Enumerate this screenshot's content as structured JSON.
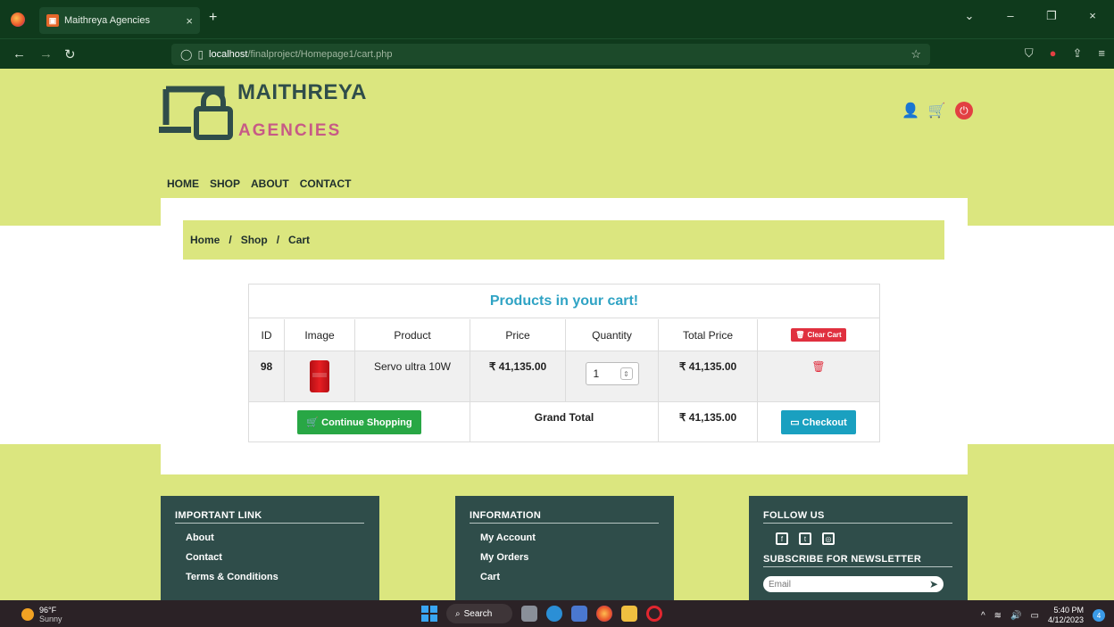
{
  "browser": {
    "tab_title": "Maithreya Agencies",
    "tab_close": "×",
    "new_tab": "+",
    "url_host": "localhost",
    "url_path": "/finalproject/Homepage1/cart.php",
    "window_controls": [
      "⌄",
      "–",
      "❐",
      "×"
    ]
  },
  "site": {
    "brand_line1": "MAITHREYA",
    "brand_line2": "AGENCIES",
    "menu": [
      "HOME",
      "SHOP",
      "ABOUT",
      "CONTACT"
    ],
    "breadcrumb": [
      "Home",
      "/",
      "Shop",
      "/",
      "Cart"
    ]
  },
  "cart": {
    "title": "Products in your cart!",
    "headers": [
      "ID",
      "Image",
      "Product",
      "Price",
      "Quantity",
      "Total Price"
    ],
    "clear_label": "Clear Cart",
    "items": [
      {
        "id": "98",
        "product": "Servo ultra 10W",
        "price": "₹ 41,135.00",
        "quantity": "1",
        "total": "₹ 41,135.00"
      }
    ],
    "continue_label": "Continue Shopping",
    "grand_total_label": "Grand Total",
    "grand_total": "₹ 41,135.00",
    "checkout_label": "Checkout"
  },
  "footer": {
    "important_title": "IMPORTANT LINK",
    "important_links": [
      "About",
      "Contact",
      "Terms & Conditions"
    ],
    "info_title": "INFORMATION",
    "info_links": [
      "My Account",
      "My Orders",
      "Cart"
    ],
    "follow_title": "FOLLOW US",
    "newsletter_title": "SUBSCRIBE FOR NEWSLETTER",
    "email_placeholder": "Email"
  },
  "taskbar": {
    "temp": "96°F",
    "weather": "Sunny",
    "search": "Search",
    "time": "5:40 PM",
    "date": "4/12/2023",
    "notifications": "4"
  },
  "colors": {
    "theme_bg": "#dbe67f",
    "dark_green": "#2f4d4a",
    "accent_pink": "#c75a86",
    "title_blue": "#2fa3c4",
    "danger": "#e0303f",
    "success": "#28a745"
  }
}
